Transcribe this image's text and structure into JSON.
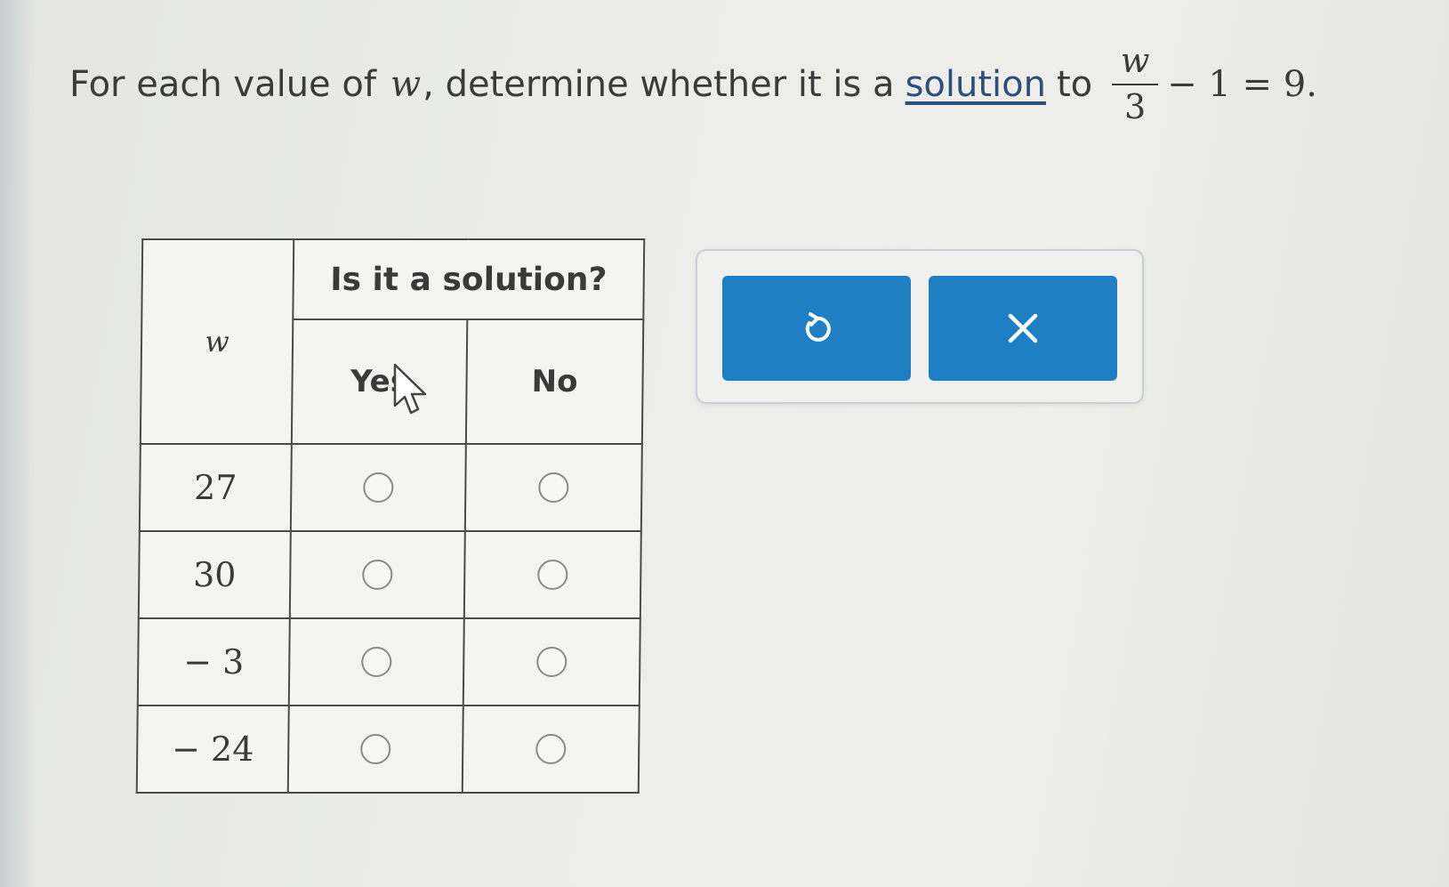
{
  "question": {
    "prefix": "For each value of",
    "variable": "w",
    "middle": ", determine whether it is a",
    "link_text": "solution",
    "to_text": "to",
    "fraction_numerator": "w",
    "fraction_denominator": "3",
    "rhs_minus": "− 1 = 9",
    "period": "."
  },
  "table": {
    "header_main": "Is it a solution?",
    "header_variable": "w",
    "header_yes": "Yes",
    "header_no": "No",
    "rows": [
      {
        "value": "27",
        "yes_selected": false,
        "no_selected": false
      },
      {
        "value": "30",
        "yes_selected": false,
        "no_selected": false
      },
      {
        "value": "− 3",
        "yes_selected": false,
        "no_selected": false
      },
      {
        "value": "− 24",
        "yes_selected": false,
        "no_selected": false
      }
    ]
  },
  "tools": {
    "undo_icon": "undo-icon",
    "clear_icon": "close-icon"
  },
  "colors": {
    "button_blue": "#1f7fc3",
    "link_blue": "#2f4f7a",
    "table_border": "#4a4a4a"
  }
}
